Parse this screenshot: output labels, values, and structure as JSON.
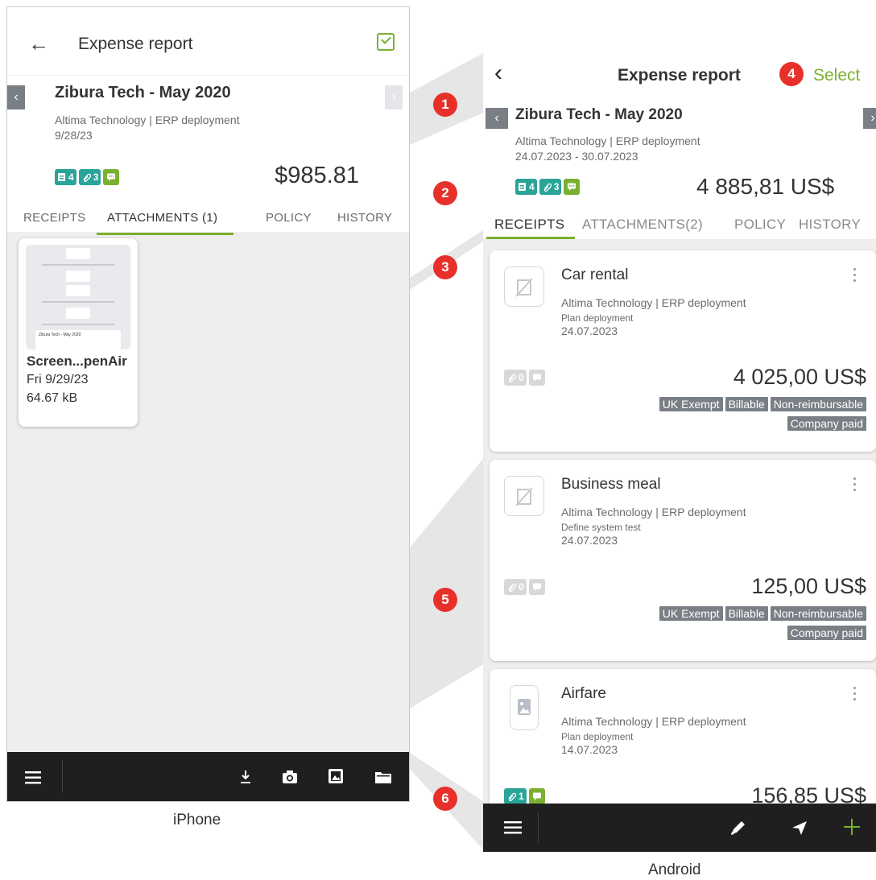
{
  "iphone": {
    "header": {
      "back_icon": "arrow-left-icon",
      "title": "Expense report",
      "select_icon": "checkbox-check-icon"
    },
    "report": {
      "name": "Zibura Tech - May 2020",
      "subtitle": "Altima Technology | ERP deployment",
      "date": "9/28/23",
      "badges": {
        "receipts": "4",
        "attachments": "3"
      },
      "total": "$985.81"
    },
    "tabs": [
      "RECEIPTS",
      "ATTACHMENTS (1)",
      "POLICY",
      "HISTORY"
    ],
    "active_tab": "ATTACHMENTS (1)",
    "attachment": {
      "name": "Screen...penAir",
      "date": "Fri 9/29/23",
      "size": "64.67 kB",
      "thumb_caption": "Zibura Tech - May 2020"
    },
    "bottom_bar": [
      "menu-icon",
      "download-icon",
      "camera-icon",
      "gallery-icon",
      "folder-icon"
    ],
    "caption": "iPhone"
  },
  "android": {
    "header": {
      "back_icon": "chevron-left-icon",
      "title": "Expense report",
      "select_label": "Select"
    },
    "report": {
      "name": "Zibura Tech - May 2020",
      "subtitle": "Altima Technology | ERP deployment",
      "date_range": "24.07.2023 - 30.07.2023",
      "badges": {
        "receipts": "4",
        "attachments": "3"
      },
      "total": "4 885,81 US$"
    },
    "tabs": [
      "RECEIPTS",
      "ATTACHMENTS(2)",
      "POLICY",
      "HISTORY"
    ],
    "active_tab": "RECEIPTS",
    "receipts": [
      {
        "title": "Car rental",
        "subtitle": "Altima Technology | ERP deployment",
        "task": "Plan deployment",
        "date": "24.07.2023",
        "attachments": "0",
        "amount": "4 025,00 US$",
        "tags": [
          "UK Exempt",
          "Billable",
          "Non-reimbursable",
          "Company paid"
        ]
      },
      {
        "title": "Business meal",
        "subtitle": "Altima Technology | ERP deployment",
        "task": "Define system test",
        "date": "24.07.2023",
        "attachments": "0",
        "amount": "125,00 US$",
        "tags": [
          "UK Exempt",
          "Billable",
          "Non-reimbursable",
          "Company paid"
        ]
      },
      {
        "title": "Airfare",
        "subtitle": "Altima Technology | ERP deployment",
        "task": "Plan deployment",
        "date": "14.07.2023",
        "attachments": "1",
        "amount": "156,85 US$",
        "tags": []
      }
    ],
    "bottom_bar": [
      "menu-icon",
      "pencil-icon",
      "send-icon",
      "plus-icon"
    ],
    "caption": "Android"
  },
  "markers": [
    "1",
    "2",
    "3",
    "4",
    "5",
    "6"
  ],
  "colors": {
    "accent": "#7ab030",
    "marker": "#e8302a",
    "bar": "#1f1f1f",
    "chip": "#7a7f86",
    "teal": "#2aa399"
  }
}
